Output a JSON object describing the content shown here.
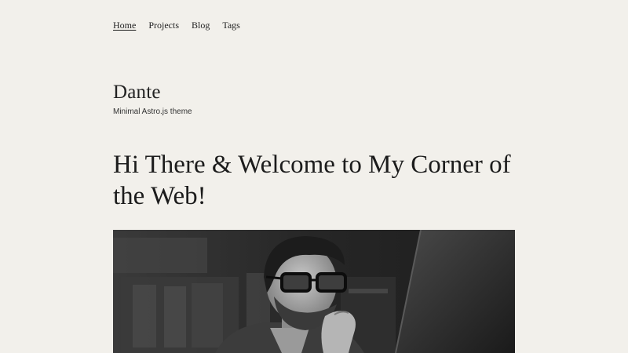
{
  "nav": {
    "items": [
      {
        "label": "Home",
        "active": true
      },
      {
        "label": "Projects",
        "active": false
      },
      {
        "label": "Blog",
        "active": false
      },
      {
        "label": "Tags",
        "active": false
      }
    ]
  },
  "site": {
    "title": "Dante",
    "subtitle": "Minimal Astro.js theme"
  },
  "hero": {
    "title": "Hi There & Welcome to My Corner of the Web!"
  },
  "colors": {
    "background": "#f2f0eb",
    "text": "#222222"
  }
}
